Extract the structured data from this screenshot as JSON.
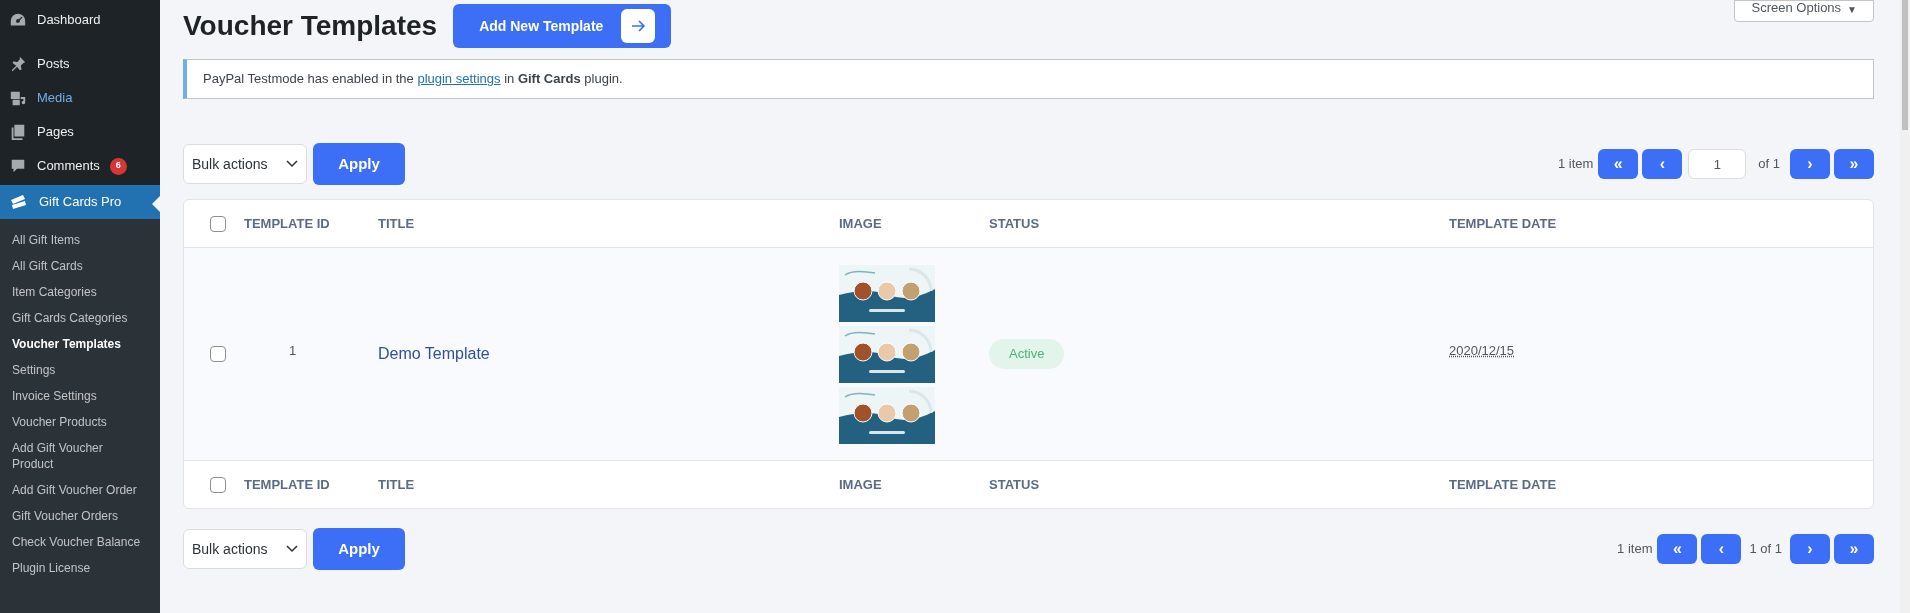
{
  "sidebar": {
    "items": [
      {
        "label": "Dashboard",
        "selected": false,
        "highlighted": false
      },
      {
        "label": "Posts",
        "selected": false,
        "highlighted": false
      },
      {
        "label": "Media",
        "selected": false,
        "highlighted": true
      },
      {
        "label": "Pages",
        "selected": false,
        "highlighted": false
      },
      {
        "label": "Comments",
        "selected": false,
        "highlighted": false,
        "badge": "6"
      },
      {
        "label": "Gift Cards Pro",
        "selected": true,
        "highlighted": false
      }
    ],
    "submenu": [
      {
        "label": "All Gift Items",
        "selected": false
      },
      {
        "label": "All Gift Cards",
        "selected": false
      },
      {
        "label": "Item Categories",
        "selected": false
      },
      {
        "label": "Gift Cards Categories",
        "selected": false
      },
      {
        "label": "Voucher Templates",
        "selected": true
      },
      {
        "label": "Settings",
        "selected": false
      },
      {
        "label": "Invoice Settings",
        "selected": false
      },
      {
        "label": "Voucher Products",
        "selected": false
      },
      {
        "label": "Add Gift Voucher Product",
        "selected": false
      },
      {
        "label": "Add Gift Voucher Order",
        "selected": false
      },
      {
        "label": "Gift Voucher Orders",
        "selected": false
      },
      {
        "label": "Check Voucher Balance",
        "selected": false
      },
      {
        "label": "Plugin License",
        "selected": false
      }
    ]
  },
  "page_title": "Voucher Templates",
  "add_button": "Add New Template",
  "screen_options": {
    "label": "Screen Options",
    "caret": "▼"
  },
  "notice": {
    "before": "PayPal Testmode has enabled in the",
    "link": "plugin settings",
    "after": "in **Gift Cards** plugin."
  },
  "top_nav": {
    "bulk_action": "Bulk actions",
    "apply": "Apply",
    "count": "1 item",
    "first": "«",
    "prev": "‹",
    "page": "1",
    "of": "of 1",
    "next": "›",
    "last": "»"
  },
  "table": {
    "columns": [
      "TEMPLATE ID",
      "TITLE",
      "IMAGE",
      "STATUS",
      "TEMPLATE DATE"
    ],
    "rows": [
      {
        "checked": false,
        "id": "1",
        "title": "Demo Template",
        "status": "Active",
        "date": "2020/12/15"
      }
    ],
    "footer_columns": [
      "TEMPLATE ID",
      "TITLE",
      "IMAGE",
      "STATUS",
      "TEMPLATE DATE"
    ],
    "header_checked": false,
    "footer_checked": false
  },
  "bottom_nav": {
    "bulk_action": "Bulk actions",
    "apply": "Apply",
    "count": "1 item",
    "first": "«",
    "prev": "‹",
    "page_text": "1 of 1",
    "next": "›",
    "last": "»"
  }
}
